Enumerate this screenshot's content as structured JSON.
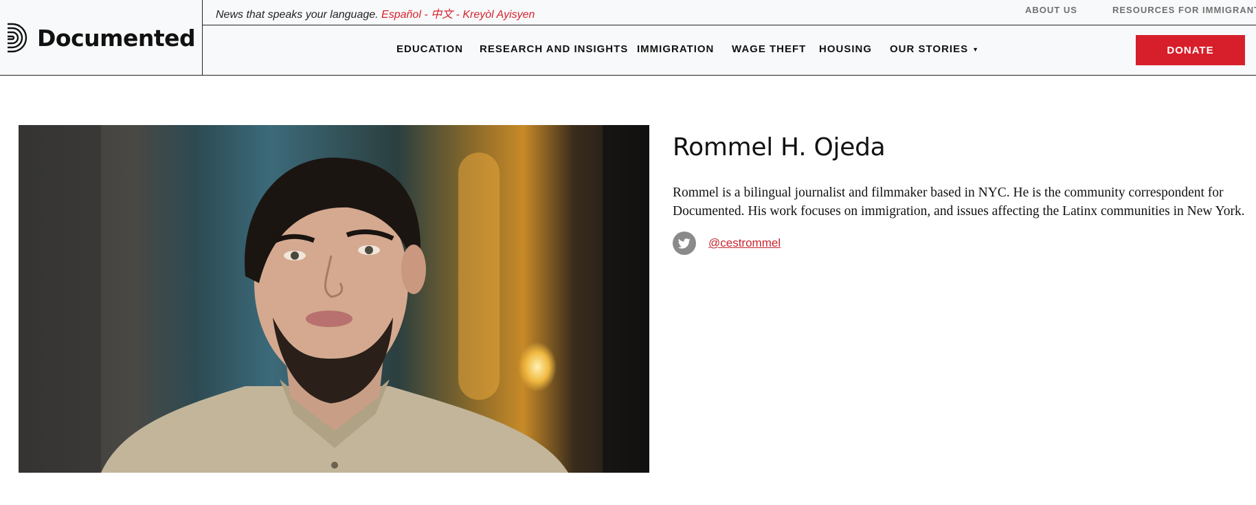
{
  "site": {
    "logo_text": "Documented",
    "tagline_prefix": "News that speaks your language.",
    "languages": [
      "Español",
      "中文",
      "Kreyòl Ayisyen"
    ],
    "separator": " - ",
    "utility_links": [
      "ABOUT US",
      "RESOURCES FOR IMMIGRANTS"
    ]
  },
  "nav": {
    "items": [
      "EDUCATION",
      "RESEARCH AND INSIGHTS",
      "IMMIGRATION",
      "WAGE THEFT",
      "HOUSING",
      "OUR STORIES"
    ],
    "donate_label": "DONATE"
  },
  "author": {
    "name": "Rommel H. Ojeda",
    "bio": "Rommel is a bilingual journalist and filmmaker based in NYC. He is the community correspondent for Documented. His work focuses on immigration, and issues affecting the Latinx communities in New York.",
    "twitter_handle": "@cestrommel"
  },
  "colors": {
    "accent": "#d71f2b",
    "header_bg": "#f8f9fa",
    "icon_gray": "#8a8a8a"
  }
}
